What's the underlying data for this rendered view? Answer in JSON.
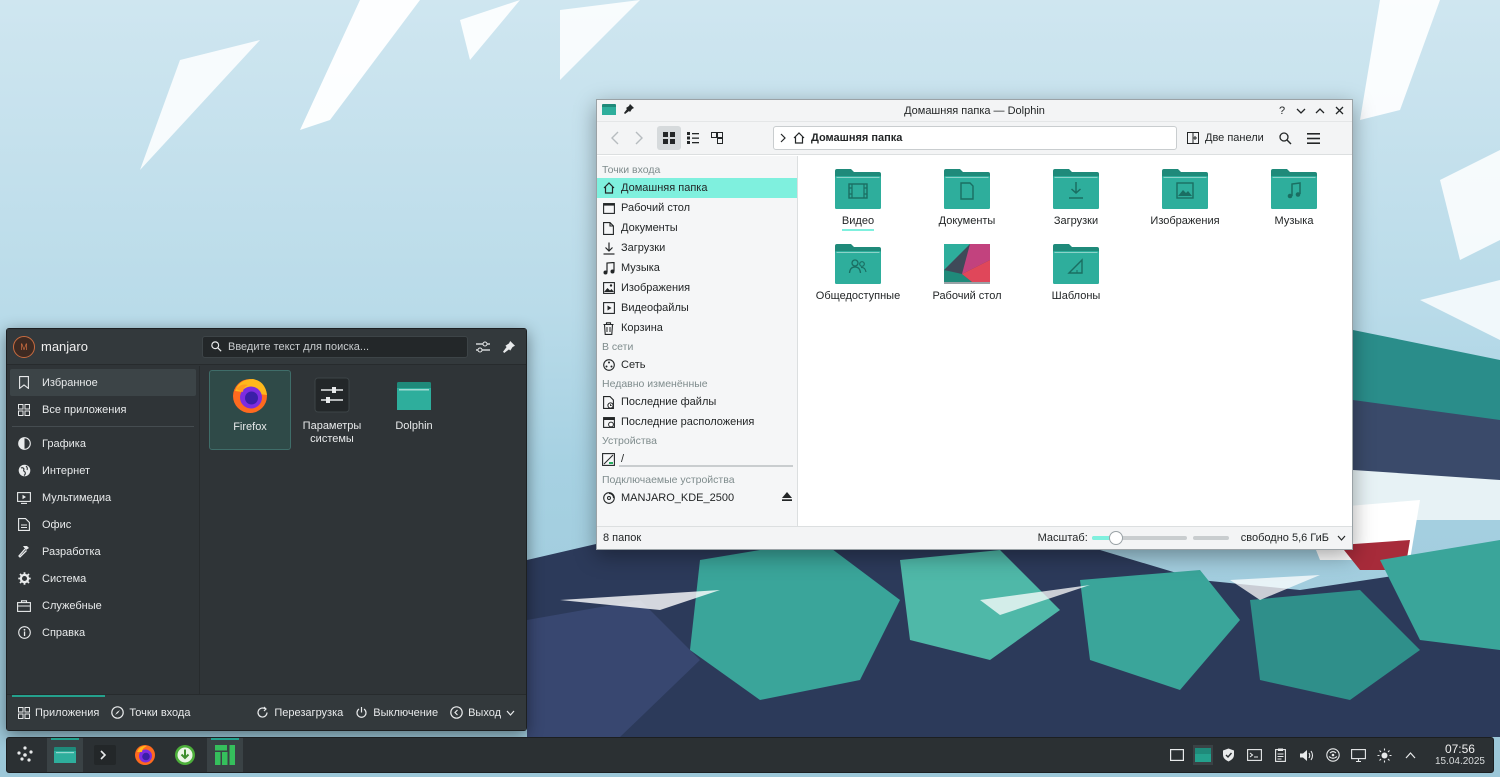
{
  "colors": {
    "accent": "#7ff0de",
    "folder": "#2eae9c",
    "folder_dark": "#1f8a7a",
    "panel_dark": "#2f3437"
  },
  "dolphin": {
    "title": "Домашняя папка — Dolphin",
    "breadcrumb": "Домашняя папка",
    "dual_panel_label": "Две панели",
    "places": {
      "sections": [
        {
          "header": "Точки входа",
          "items": [
            {
              "label": "Домашняя папка",
              "icon": "home-icon",
              "selected": true
            },
            {
              "label": "Рабочий стол",
              "icon": "desktop-icon"
            },
            {
              "label": "Документы",
              "icon": "document-icon"
            },
            {
              "label": "Загрузки",
              "icon": "download-icon"
            },
            {
              "label": "Музыка",
              "icon": "music-icon"
            },
            {
              "label": "Изображения",
              "icon": "image-icon"
            },
            {
              "label": "Видеофайлы",
              "icon": "video-icon"
            },
            {
              "label": "Корзина",
              "icon": "trash-icon"
            }
          ]
        },
        {
          "header": "В сети",
          "items": [
            {
              "label": "Сеть",
              "icon": "network-icon"
            }
          ]
        },
        {
          "header": "Недавно изменённые",
          "items": [
            {
              "label": "Последние файлы",
              "icon": "recent-files-icon"
            },
            {
              "label": "Последние расположения",
              "icon": "recent-locations-icon"
            }
          ]
        },
        {
          "header": "Устройства",
          "items": [
            {
              "label": "/",
              "icon": "drive-icon"
            }
          ]
        },
        {
          "header": "Подключаемые устройства",
          "items": [
            {
              "label": "MANJARO_KDE_2500",
              "icon": "optical-disc-icon"
            }
          ]
        }
      ]
    },
    "folders": [
      {
        "label": "Видео",
        "icon": "video-folder-icon",
        "selected": true
      },
      {
        "label": "Документы",
        "icon": "documents-folder-icon"
      },
      {
        "label": "Загрузки",
        "icon": "downloads-folder-icon"
      },
      {
        "label": "Изображения",
        "icon": "pictures-folder-icon"
      },
      {
        "label": "Музыка",
        "icon": "music-folder-icon"
      },
      {
        "label": "Общедоступные",
        "icon": "public-folder-icon"
      },
      {
        "label": "Рабочий стол",
        "icon": "desktop-folder-icon"
      },
      {
        "label": "Шаблоны",
        "icon": "templates-folder-icon"
      }
    ],
    "status": {
      "count": "8 папок",
      "zoom_label": "Масштаб:",
      "zoom_level": 0.25,
      "free_space": "свободно 5,6 ГиБ"
    }
  },
  "launcher": {
    "user": "manjaro",
    "avatar_text": "M",
    "search_placeholder": "Введите текст для поиска...",
    "categories_top": [
      {
        "label": "Избранное",
        "icon": "bookmark-icon",
        "selected": true
      },
      {
        "label": "Все приложения",
        "icon": "grid-icon"
      }
    ],
    "categories": [
      {
        "label": "Графика",
        "icon": "graphics-icon"
      },
      {
        "label": "Интернет",
        "icon": "globe-icon"
      },
      {
        "label": "Мультимедиа",
        "icon": "multimedia-icon"
      },
      {
        "label": "Офис",
        "icon": "office-icon"
      },
      {
        "label": "Разработка",
        "icon": "hammer-icon"
      },
      {
        "label": "Система",
        "icon": "system-gear-icon"
      },
      {
        "label": "Служебные",
        "icon": "utilities-icon"
      },
      {
        "label": "Справка",
        "icon": "help-icon"
      }
    ],
    "apps": [
      {
        "label": "Firefox",
        "icon": "firefox-icon",
        "selected": true
      },
      {
        "label": "Параметры системы",
        "icon": "settings-icon"
      },
      {
        "label": "Dolphin",
        "icon": "dolphin-icon"
      }
    ],
    "footer": {
      "applications": "Приложения",
      "places": "Точки входа",
      "reboot": "Перезагрузка",
      "shutdown": "Выключение",
      "logout": "Выход"
    }
  },
  "taskbar": {
    "clock": {
      "time": "07:56",
      "date": "15.04.2025"
    }
  }
}
